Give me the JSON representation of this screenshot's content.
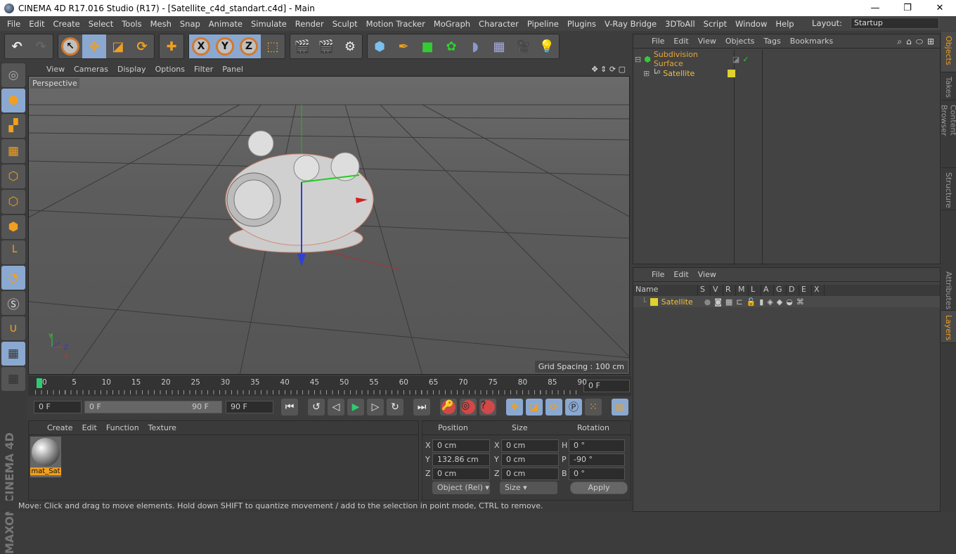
{
  "window": {
    "title": "CINEMA 4D R17.016 Studio (R17) - [Satellite_c4d_standart.c4d] - Main",
    "controls": [
      "—",
      "❐",
      "✕"
    ]
  },
  "menubar": {
    "items": [
      "File",
      "Edit",
      "Create",
      "Select",
      "Tools",
      "Mesh",
      "Snap",
      "Animate",
      "Simulate",
      "Render",
      "Sculpt",
      "Motion Tracker",
      "MoGraph",
      "Character",
      "Pipeline",
      "Plugins",
      "V-Ray Bridge",
      "3DToAll",
      "Script",
      "Window",
      "Help"
    ],
    "layout_label": "Layout:",
    "layout_value": "Startup"
  },
  "toolbar": {
    "icons": [
      "undo-icon",
      "redo-icon",
      "select-icon",
      "move-icon",
      "scale-icon",
      "rotate-icon",
      "add-icon",
      "x-axis-icon",
      "y-axis-icon",
      "z-axis-icon",
      "coordinate-system-icon",
      "render-view-icon",
      "render-picture-viewer-icon",
      "render-settings-icon",
      "cube-icon",
      "pen-icon",
      "subdivision-icon",
      "array-icon",
      "deformer-icon",
      "floor-icon",
      "camera-icon",
      "light-icon"
    ],
    "axis_labels": [
      "X",
      "Y",
      "Z"
    ]
  },
  "viewport": {
    "menu": [
      "View",
      "Cameras",
      "Display",
      "Options",
      "Filter",
      "Panel"
    ],
    "label": "Perspective",
    "grid_spacing": "Grid Spacing : 100 cm",
    "axis_labels": [
      "Y",
      "Z",
      "X"
    ]
  },
  "timeline": {
    "ticks": [
      "0",
      "5",
      "10",
      "15",
      "20",
      "25",
      "30",
      "35",
      "40",
      "45",
      "50",
      "55",
      "60",
      "65",
      "70",
      "75",
      "80",
      "85",
      "90"
    ],
    "current_frame": "0 F",
    "start": "0 F",
    "range_start": "0 F",
    "range_end": "90 F",
    "end": "90 F"
  },
  "materials": {
    "menu": [
      "Create",
      "Edit",
      "Function",
      "Texture"
    ],
    "items": [
      {
        "name": "mat_Sat"
      }
    ]
  },
  "coordinates": {
    "headers": [
      "Position",
      "Size",
      "Rotation"
    ],
    "rows": [
      {
        "pl": "X",
        "p": "0 cm",
        "sl": "X",
        "s": "0 cm",
        "rl": "H",
        "r": "0 °"
      },
      {
        "pl": "Y",
        "p": "132.86 cm",
        "sl": "Y",
        "s": "0 cm",
        "rl": "P",
        "r": "-90 °"
      },
      {
        "pl": "Z",
        "p": "0 cm",
        "sl": "Z",
        "s": "0 cm",
        "rl": "B",
        "r": "0 °"
      }
    ],
    "mode": "Object (Rel)",
    "size_mode": "Size",
    "apply": "Apply"
  },
  "status": "Move: Click and drag to move elements. Hold down SHIFT to quantize movement / add to the selection in point mode, CTRL to remove.",
  "objects": {
    "menu": [
      "File",
      "Edit",
      "View",
      "Objects",
      "Tags",
      "Bookmarks"
    ],
    "items": [
      {
        "name": "Subdivision Surface",
        "color": "#e8a63a"
      },
      {
        "name": "Satellite",
        "color": "#f0c040"
      }
    ]
  },
  "layers": {
    "menu": [
      "File",
      "Edit",
      "View"
    ],
    "columns": [
      "Name",
      "S",
      "V",
      "R",
      "M",
      "L",
      "A",
      "G",
      "D",
      "E",
      "X"
    ],
    "items": [
      {
        "name": "Satellite",
        "color": "#e0d030"
      }
    ]
  },
  "side_tabs": [
    "Objects",
    "Takes",
    "Content Browser",
    "Structure",
    "Attributes",
    "Layers"
  ],
  "brand": "MAXON CINEMA 4D"
}
